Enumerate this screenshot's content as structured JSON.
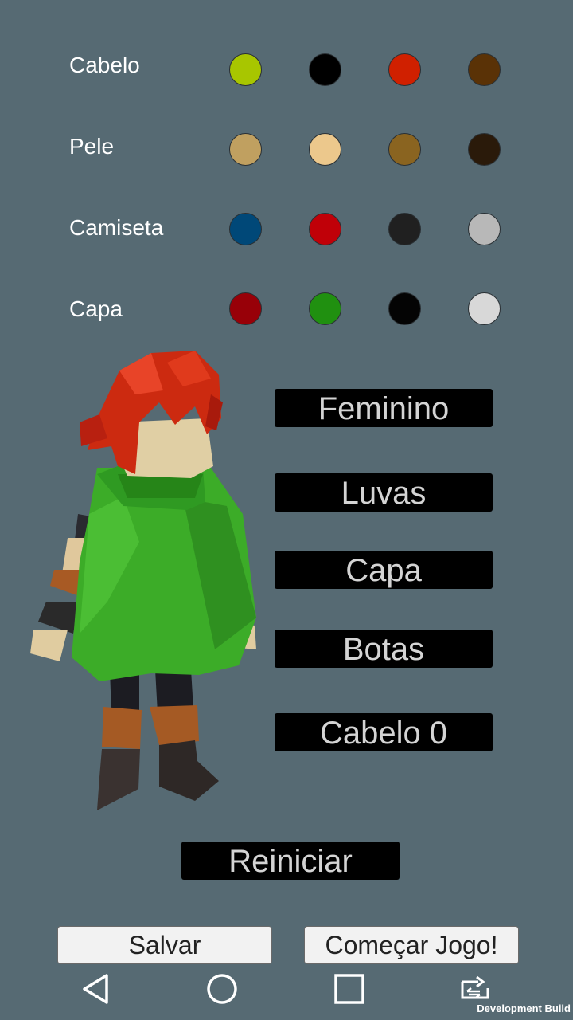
{
  "rows": [
    {
      "label": "Cabelo",
      "colors": [
        "#a8c600",
        "#000000",
        "#d02000",
        "#5a3206"
      ]
    },
    {
      "label": "Pele",
      "colors": [
        "#c0a060",
        "#ecc88c",
        "#8a6420",
        "#2a1a0a"
      ]
    },
    {
      "label": "Camiseta",
      "colors": [
        "#004878",
        "#c00008",
        "#202020",
        "#b8b8b8"
      ]
    },
    {
      "label": "Capa",
      "colors": [
        "#980008",
        "#209010",
        "#040404",
        "#d8d8d8"
      ]
    }
  ],
  "buttons": {
    "gender": "Feminino",
    "gloves": "Luvas",
    "cape": "Capa",
    "boots": "Botas",
    "hair": "Cabelo 0",
    "restart": "Reiniciar",
    "save": "Salvar",
    "start": "Começar Jogo!"
  },
  "dev_build": "Development Build"
}
